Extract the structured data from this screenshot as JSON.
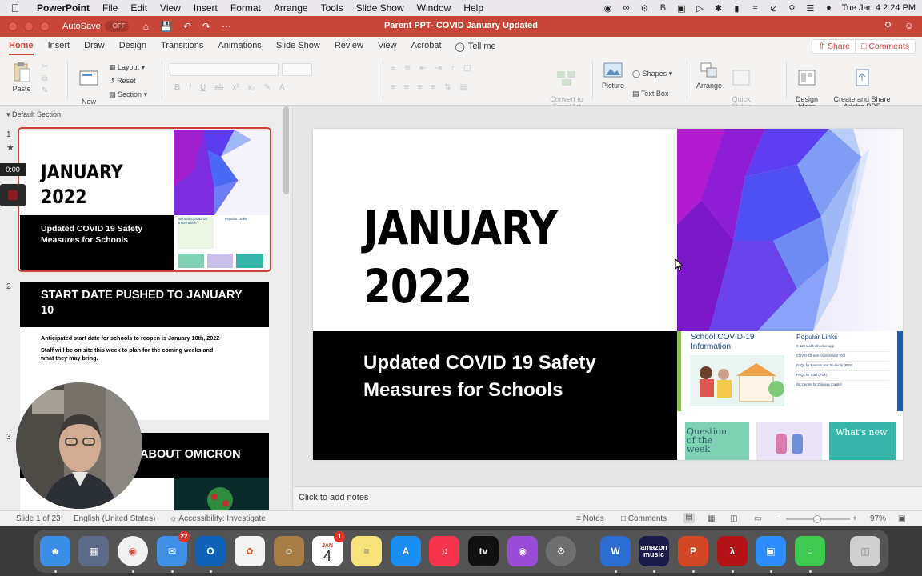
{
  "menubar": {
    "app_name": "PowerPoint",
    "items": [
      "File",
      "Edit",
      "View",
      "Insert",
      "Format",
      "Arrange",
      "Tools",
      "Slide Show",
      "Window",
      "Help"
    ],
    "clock": "Tue Jan 4  2:24 PM"
  },
  "titlebar": {
    "autosave_label": "AutoSave",
    "autosave_state": "OFF",
    "doc_title": "Parent PPT- COVID January Updated"
  },
  "ribbon_tabs": {
    "tabs": [
      "Home",
      "Insert",
      "Draw",
      "Design",
      "Transitions",
      "Animations",
      "Slide Show",
      "Review",
      "View",
      "Acrobat"
    ],
    "tell_me": "Tell me",
    "share": "Share",
    "comments": "Comments"
  },
  "ribbon": {
    "paste": "Paste",
    "new_slide": "New\nSlide",
    "layout": "Layout",
    "reset": "Reset",
    "section": "Section",
    "convert_smartart": "Convert to\nSmartArt",
    "picture": "Picture",
    "shapes": "Shapes",
    "text_box": "Text Box",
    "arrange": "Arrange",
    "quick_styles": "Quick\nStyles",
    "design_ideas": "Design\nIdeas",
    "create_share_pdf": "Create and Share\nAdobe PDF"
  },
  "thumbnails": {
    "section": "Default Section",
    "recording_time": "0:00",
    "slides": [
      {
        "num": "1",
        "title": "JANUARY\n2022",
        "subtitle": "Updated COVID 19 Safety\nMeasures for Schools",
        "site_heading": "School COVID-19\nInformation",
        "site_links_title": "Popular Links"
      },
      {
        "num": "2",
        "title": "START DATE PUSHED TO JANUARY\n10",
        "line1": "Anticipated start date for schools to reopen is January 10th, 2022",
        "line2": "Staff will be on site this week to plan for the coming weeks and\nwhat they may bring."
      },
      {
        "num": "3",
        "title": "ABOUT OMICRON"
      }
    ]
  },
  "slide": {
    "title_line1": "JANUARY",
    "title_line2": "2022",
    "subtitle_line1": "Updated COVID 19 Safety",
    "subtitle_line2": "Measures for Schools",
    "site_heading": "School COVID-19\nInformation",
    "popular_links": "Popular Links",
    "links": [
      "K-12 Health Checker app",
      "COVID-19 Self-Assessment Tool",
      "FAQs for Parents and Students (PDF)",
      "FAQs for Staff (PDF)",
      "BC Centre for Disease Control"
    ],
    "tile1": "Question\nof the\nweek",
    "tile3": "What's new"
  },
  "notes_placeholder": "Click to add notes",
  "statusbar": {
    "slide_of": "Slide 1 of 23",
    "language": "English (United States)",
    "accessibility": "Accessibility: Investigate",
    "notes": "Notes",
    "comments": "Comments",
    "zoom": "97%"
  },
  "dock": {
    "mail_badge": "22",
    "calendar_month": "JAN",
    "calendar_day": "4",
    "calendar_badge": "1",
    "amazon_label": "amazon\nmusic"
  },
  "colors": {
    "accent": "#c8453a",
    "slide_black": "#000000",
    "poly_purple": "#6a1fd6"
  }
}
